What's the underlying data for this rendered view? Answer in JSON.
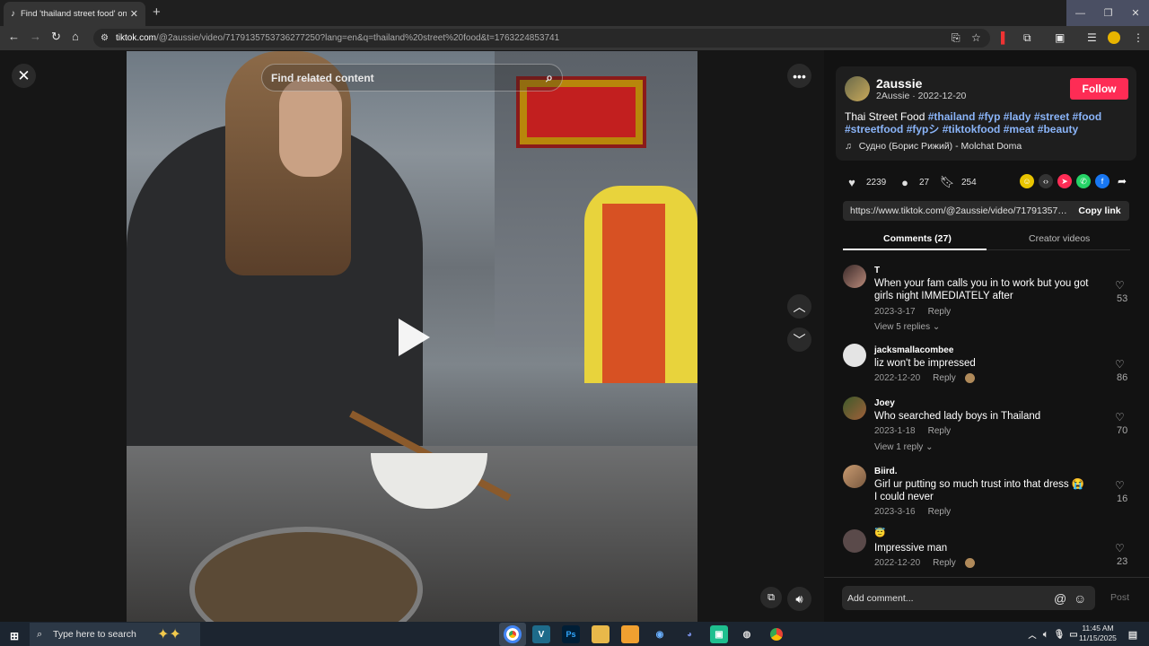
{
  "browser": {
    "tab_title": "Find 'thailand street food' on Ti",
    "url_domain": "tiktok.com",
    "url_path": "/@2aussie/video/7179135753736277250?lang=en&q=thailand%20street%20food&t=1763224853741",
    "window_buttons": [
      "—",
      "❐",
      "✕"
    ]
  },
  "video": {
    "search_placeholder": "Find related content"
  },
  "author": {
    "username": "2aussie",
    "subline": "2Aussie · 2022-12-20",
    "follow_label": "Follow"
  },
  "description": {
    "text": "Thai Street Food",
    "hashtags": [
      "#thailand",
      "#fyp",
      "#lady",
      "#street",
      "#food",
      "#streetfood",
      "#fypシ",
      "#tiktokfood",
      "#meat",
      "#beauty"
    ],
    "music": "Судно (Борис Рижий) - Molchat Doma"
  },
  "stats": {
    "likes": "2239",
    "comments": "27",
    "saves": "254"
  },
  "share": {
    "link": "https://www.tiktok.com/@2aussie/video/717913575373...",
    "copy_label": "Copy link"
  },
  "tabs": {
    "comments": "Comments (27)",
    "creator": "Creator videos"
  },
  "comments": [
    {
      "user": "T",
      "text": "When your fam calls you in to work but you got girls night IMMEDIATELY after",
      "date": "2023-3-17",
      "reply": "Reply",
      "likes": "53",
      "view_replies": "View 5 replies ⌄"
    },
    {
      "user": "jacksmallacombee",
      "text": "liz won't be impressed",
      "date": "2022-12-20",
      "reply": "Reply",
      "likes": "86",
      "view_replies": ""
    },
    {
      "user": "Joey",
      "text": "Who searched lady boys in Thailand",
      "date": "2023-1-18",
      "reply": "Reply",
      "likes": "70",
      "view_replies": "View 1 reply ⌄"
    },
    {
      "user": "Biird.",
      "text": "Girl ur putting so much trust into that dress 😭 I could never",
      "date": "2023-3-16",
      "reply": "Reply",
      "likes": "16",
      "view_replies": ""
    },
    {
      "user": "😇",
      "text": "Impressive man",
      "date": "2022-12-20",
      "reply": "Reply",
      "likes": "23",
      "view_replies": ""
    }
  ],
  "add_comment": {
    "placeholder": "Add comment...",
    "post": "Post"
  },
  "taskbar": {
    "search_placeholder": "Type here to search",
    "time": "11:45 AM",
    "date": "11/15/2025"
  }
}
